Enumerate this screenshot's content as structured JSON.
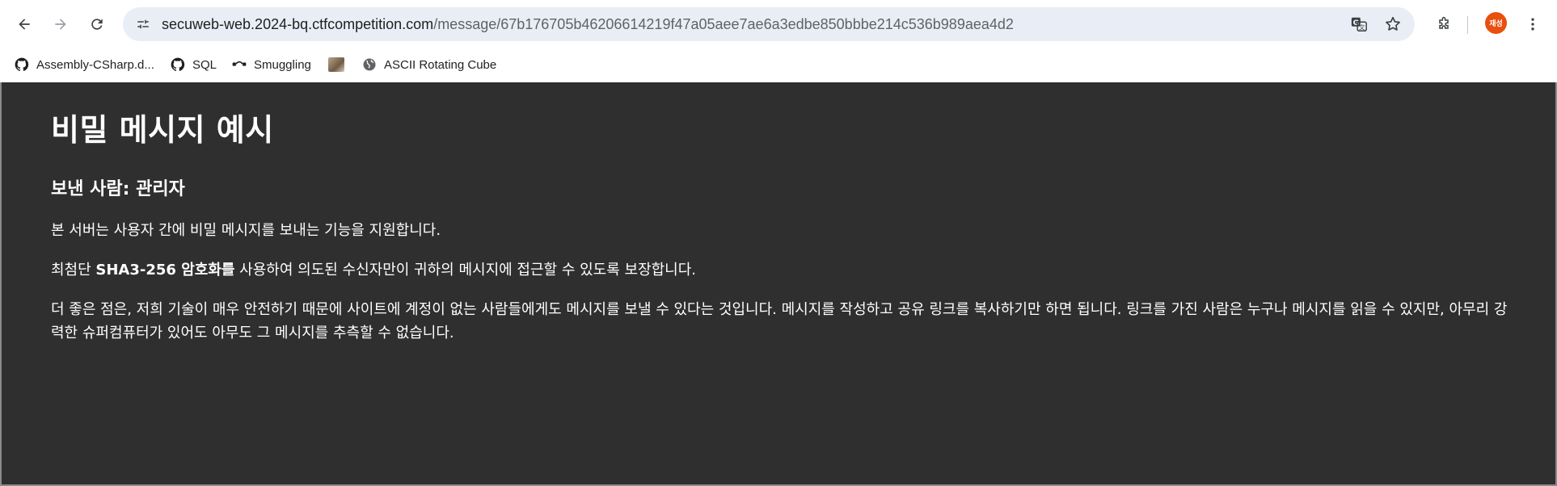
{
  "browser": {
    "url_host": "secuweb-web.2024-bq.ctfcompetition.com",
    "url_path": "/message/67b176705b46206614219f47a05aee7ae6a3edbe850bbbe214c536b989aea4d2",
    "profile_label": "재성",
    "icons": {
      "back": "arrow-left-icon",
      "forward": "arrow-right-icon",
      "reload": "reload-icon",
      "site_info": "tune-icon",
      "translate": "translate-icon",
      "bookmark": "star-icon",
      "extensions": "puzzle-icon",
      "menu": "kebab-menu-icon"
    },
    "bookmarks": [
      {
        "label": "Assembly-CSharp.d...",
        "icon": "github-icon"
      },
      {
        "label": "SQL",
        "icon": "github-icon"
      },
      {
        "label": "Smuggling",
        "icon": "link-icon"
      },
      {
        "label": "",
        "icon": "image-thumbnail"
      },
      {
        "label": "ASCII Rotating Cube",
        "icon": "globe-icon"
      }
    ]
  },
  "page": {
    "title": "비밀 메시지 예시",
    "sender": "보낸 사람: 관리자",
    "paragraph1": "본 서버는 사용자 간에 비밀 메시지를 보내는 기능을 지원합니다.",
    "paragraph2_pre": "최첨단 ",
    "paragraph2_bold": "SHA3-256 암호화를",
    "paragraph2_post": " 사용하여 의도된 수신자만이 귀하의 메시지에 접근할 수 있도록 보장합니다.",
    "paragraph3": "더 좋은 점은, 저희 기술이 매우 안전하기 때문에 사이트에 계정이 없는 사람들에게도 메시지를 보낼 수 있다는 것입니다. 메시지를 작성하고 공유 링크를 복사하기만 하면 됩니다. 링크를 가진 사람은 누구나 메시지를 읽을 수 있지만, 아무리 강력한 슈퍼컴퓨터가 있어도 아무도 그 메시지를 추측할 수 없습니다."
  },
  "colors": {
    "page_background": "#2f2f2f",
    "text": "#ffffff",
    "omnibox": "#e9eef6",
    "avatar": "#e8500e"
  }
}
